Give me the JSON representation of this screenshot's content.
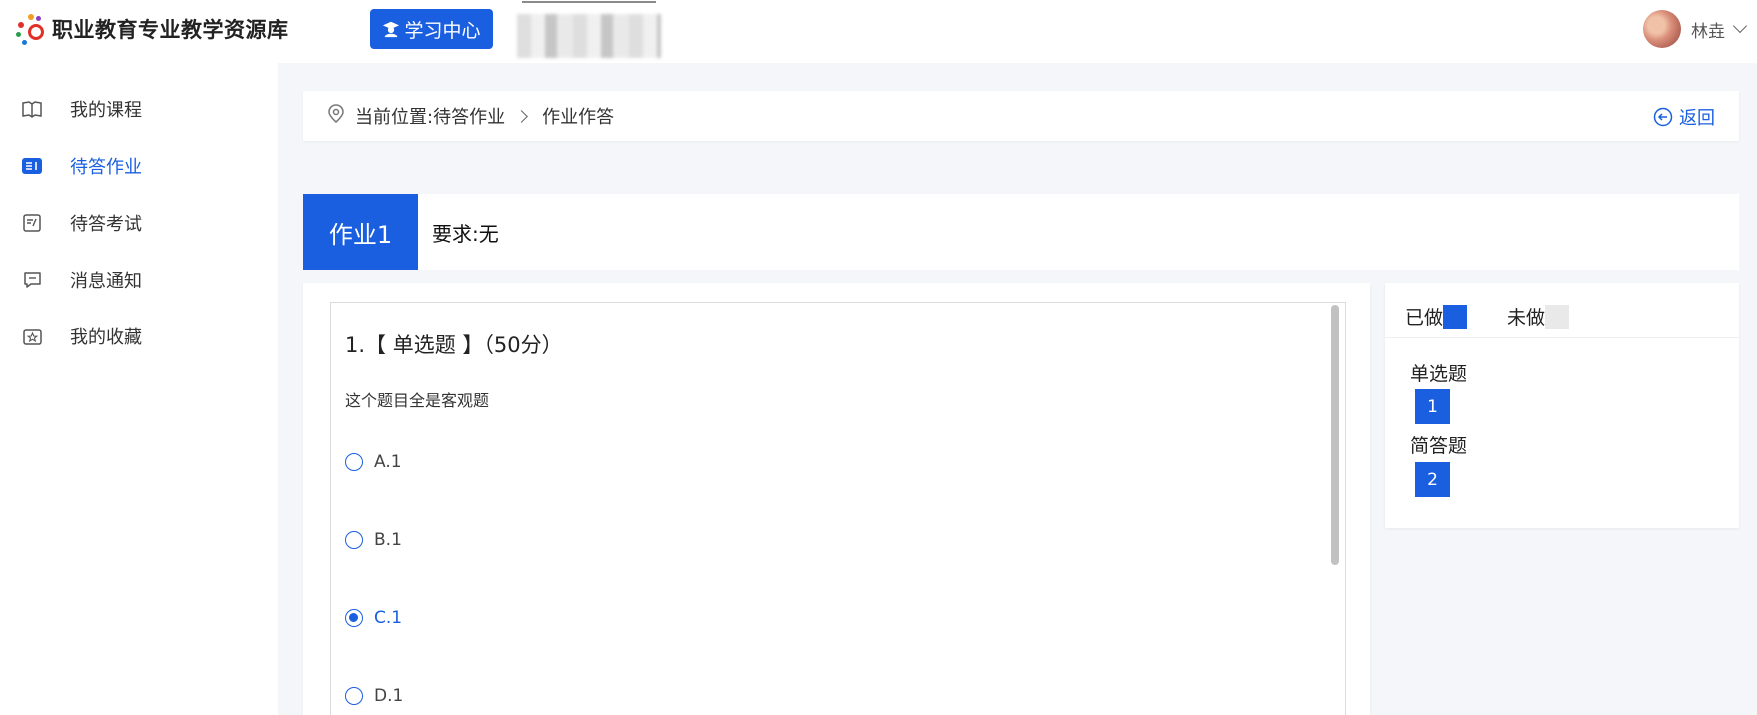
{
  "header": {
    "site_title": "职业教育专业教学资源库",
    "learning_center": "学习中心",
    "user_name": "林垚"
  },
  "sidebar": {
    "items": [
      {
        "label": "我的课程",
        "icon": "book-icon"
      },
      {
        "label": "待答作业",
        "icon": "homework-icon",
        "active": true
      },
      {
        "label": "待答考试",
        "icon": "exam-icon"
      },
      {
        "label": "消息通知",
        "icon": "message-icon"
      },
      {
        "label": "我的收藏",
        "icon": "favorite-icon"
      }
    ]
  },
  "breadcrumb": {
    "current": "当前位置:待答作业",
    "page": "作业作答",
    "back": "返回"
  },
  "homework": {
    "tag": "作业1",
    "requirement": "要求:无"
  },
  "question": {
    "title": "1.【 单选题 】（50分）",
    "stem": "这个题目全是客观题",
    "options": [
      {
        "label": "A.1",
        "selected": false
      },
      {
        "label": "B.1",
        "selected": false
      },
      {
        "label": "C.1",
        "selected": true
      },
      {
        "label": "D.1",
        "selected": false
      }
    ]
  },
  "answer_sheet": {
    "done_label": "已做",
    "todo_label": "未做",
    "sections": [
      {
        "label": "单选题",
        "numbers": [
          "1"
        ]
      },
      {
        "label": "简答题",
        "numbers": [
          "2"
        ]
      }
    ]
  },
  "colors": {
    "accent": "#1a5fe0",
    "page_bg": "#f4f6f9"
  }
}
